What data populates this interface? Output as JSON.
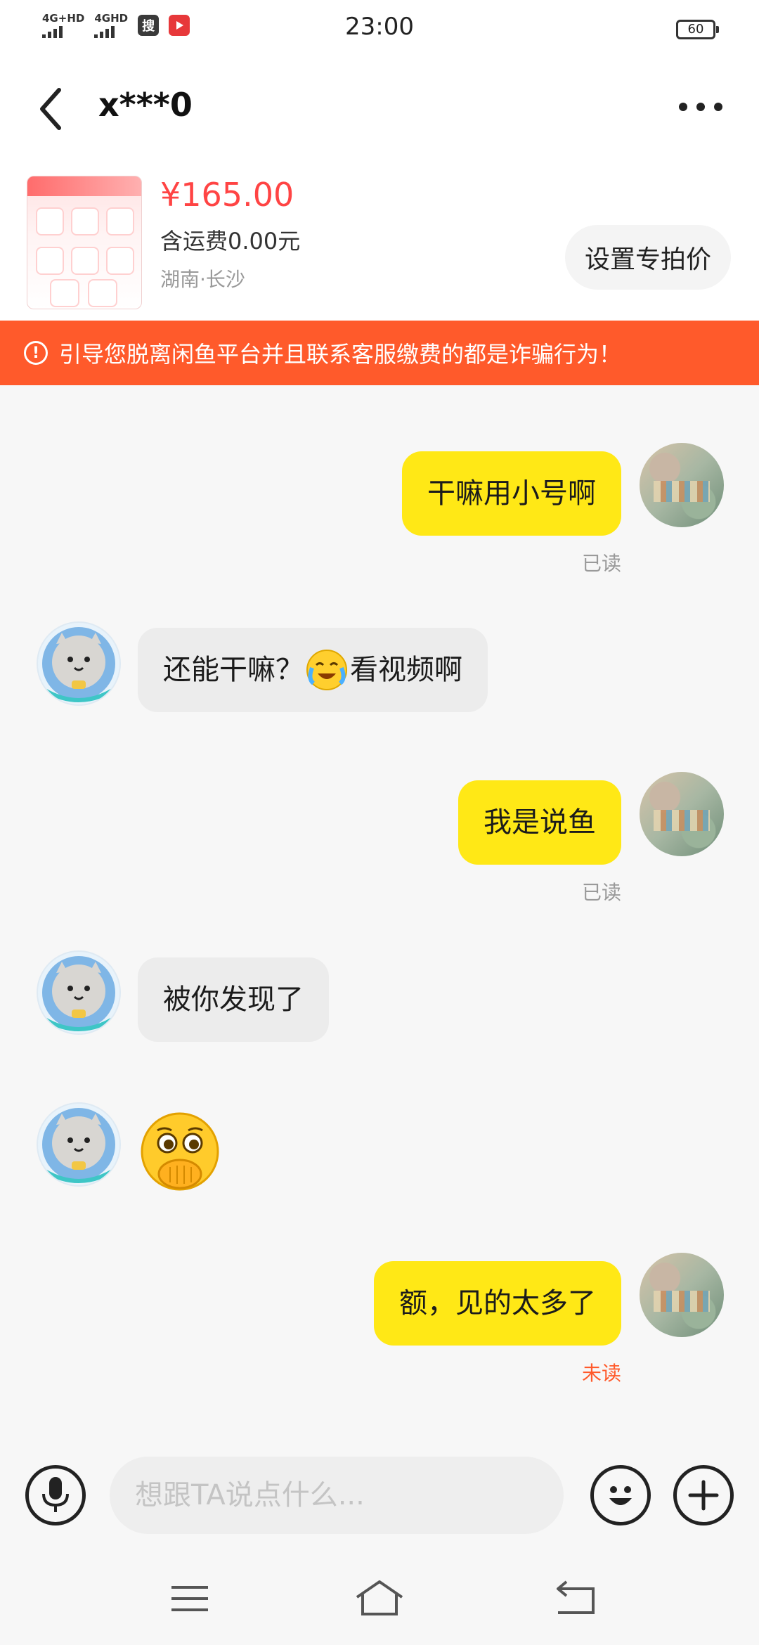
{
  "status_bar": {
    "signal1_label": "4G+HD",
    "signal2_label": "4GHD",
    "app1_label": "搜",
    "time": "23:00",
    "battery": "60"
  },
  "header": {
    "title": "x***0"
  },
  "product": {
    "price": "¥165.00",
    "shipping": "含运费0.00元",
    "location": "湖南·长沙",
    "button_label": "设置专拍价"
  },
  "warning": {
    "text": "引导您脱离闲鱼平台并且联系客服缴费的都是诈骗行为！"
  },
  "messages": [
    {
      "side": "me",
      "text": "干嘛用小号啊",
      "status": "已读"
    },
    {
      "side": "other",
      "text_before": "还能干嘛？",
      "emoji": "crying-laughing-emoji",
      "text_after": "看视频啊"
    },
    {
      "side": "me",
      "text": "我是说鱼",
      "status": "已读"
    },
    {
      "side": "other",
      "text": "被你发现了"
    },
    {
      "side": "other",
      "emoji": "shy-covering-mouth-emoji"
    },
    {
      "side": "me",
      "text": "额，见的太多了",
      "status": "未读"
    }
  ],
  "input": {
    "placeholder": "想跟TA说点什么..."
  },
  "colors": {
    "my_bubble": "#ffe816",
    "other_bubble": "#ececec",
    "warning_bg": "#ff5a2b",
    "price": "#ff4444"
  }
}
